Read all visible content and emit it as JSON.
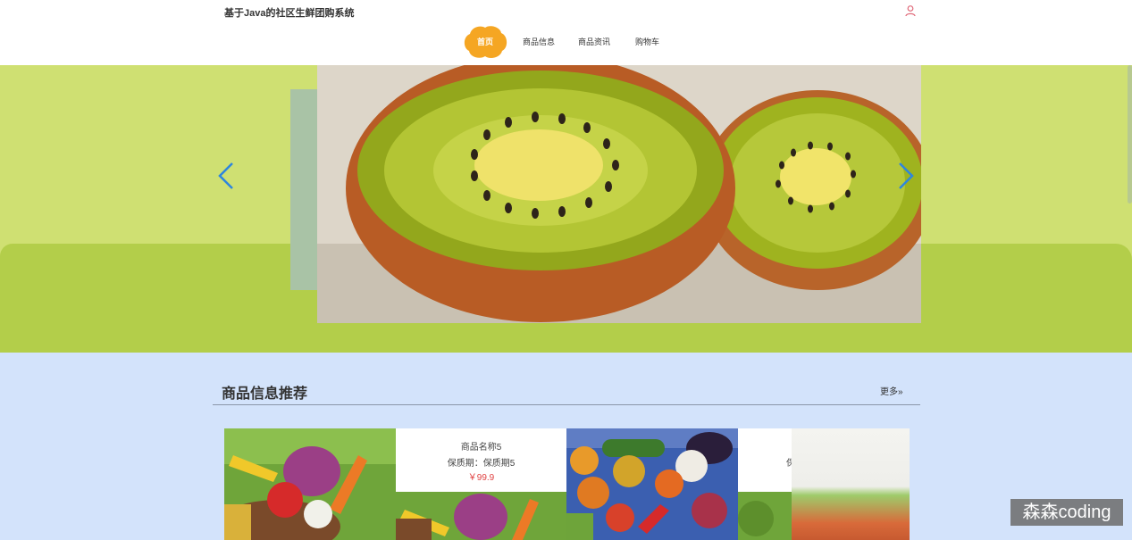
{
  "site": {
    "title": "基于Java的社区生鲜团购系统"
  },
  "nav": {
    "items": [
      {
        "label": "首页",
        "active": true
      },
      {
        "label": "商品信息"
      },
      {
        "label": "商品资讯"
      },
      {
        "label": "购物车"
      }
    ]
  },
  "header": {
    "user_icon": "user-icon"
  },
  "banner": {
    "image": "kiwi-halves",
    "prev_icon": "chevron-left-icon",
    "next_icon": "chevron-right-icon"
  },
  "section": {
    "title": "商品信息推荐",
    "more_label": "更多",
    "more_icon": "double-chevron-right-icon"
  },
  "products": [
    {
      "image": "vegetable-basket"
    },
    {
      "name": "商品名称5",
      "shelf_life": "保质期：保质期5",
      "price": "￥99.9",
      "image": "vegetable-basket"
    },
    {
      "image": "mixed-vegetables"
    },
    {
      "name": "",
      "shelf_life": "保"
    }
  ],
  "watermark": "森森coding",
  "colors": {
    "accent": "#f5a623",
    "price": "#e04040",
    "banner_bg": "#cfe072",
    "page_bg": "#d3e3fb",
    "arrow": "#2e86de"
  }
}
